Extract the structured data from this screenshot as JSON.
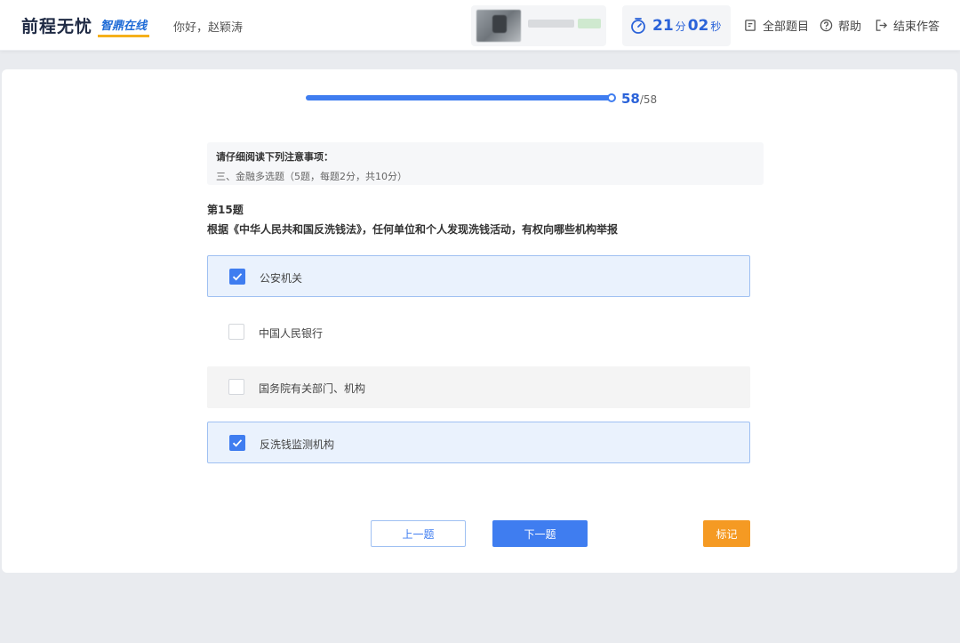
{
  "header": {
    "logo_main": "前程无忧",
    "logo_sub": "智鼎在线",
    "greeting": "你好，赵颖涛",
    "timer": {
      "minutes": "21",
      "minutes_unit": "分",
      "seconds": "02",
      "seconds_unit": "秒"
    },
    "nav": {
      "all_questions": "全部题目",
      "help": "帮助",
      "finish": "结束作答"
    }
  },
  "progress": {
    "current": "58",
    "total": "/58",
    "fraction": 1.0
  },
  "notice": {
    "title": "请仔细阅读下列注意事项：",
    "text": "三、金融多选题（5题，每题2分，共10分）"
  },
  "question": {
    "number": "第15题",
    "text": "根据《中华人民共和国反洗钱法》，任何单位和个人发现洗钱活动，有权向哪些机构举报",
    "options": [
      {
        "label": "公安机关",
        "checked": true
      },
      {
        "label": "中国人民银行",
        "checked": false
      },
      {
        "label": "国务院有关部门、机构",
        "checked": false
      },
      {
        "label": "反洗钱监测机构",
        "checked": true
      }
    ]
  },
  "buttons": {
    "prev": "上一题",
    "next": "下一题",
    "mark": "标记"
  },
  "colors": {
    "accent": "#3f7df0",
    "mark": "#f59a23",
    "checked_bg": "#eaf2fd"
  }
}
